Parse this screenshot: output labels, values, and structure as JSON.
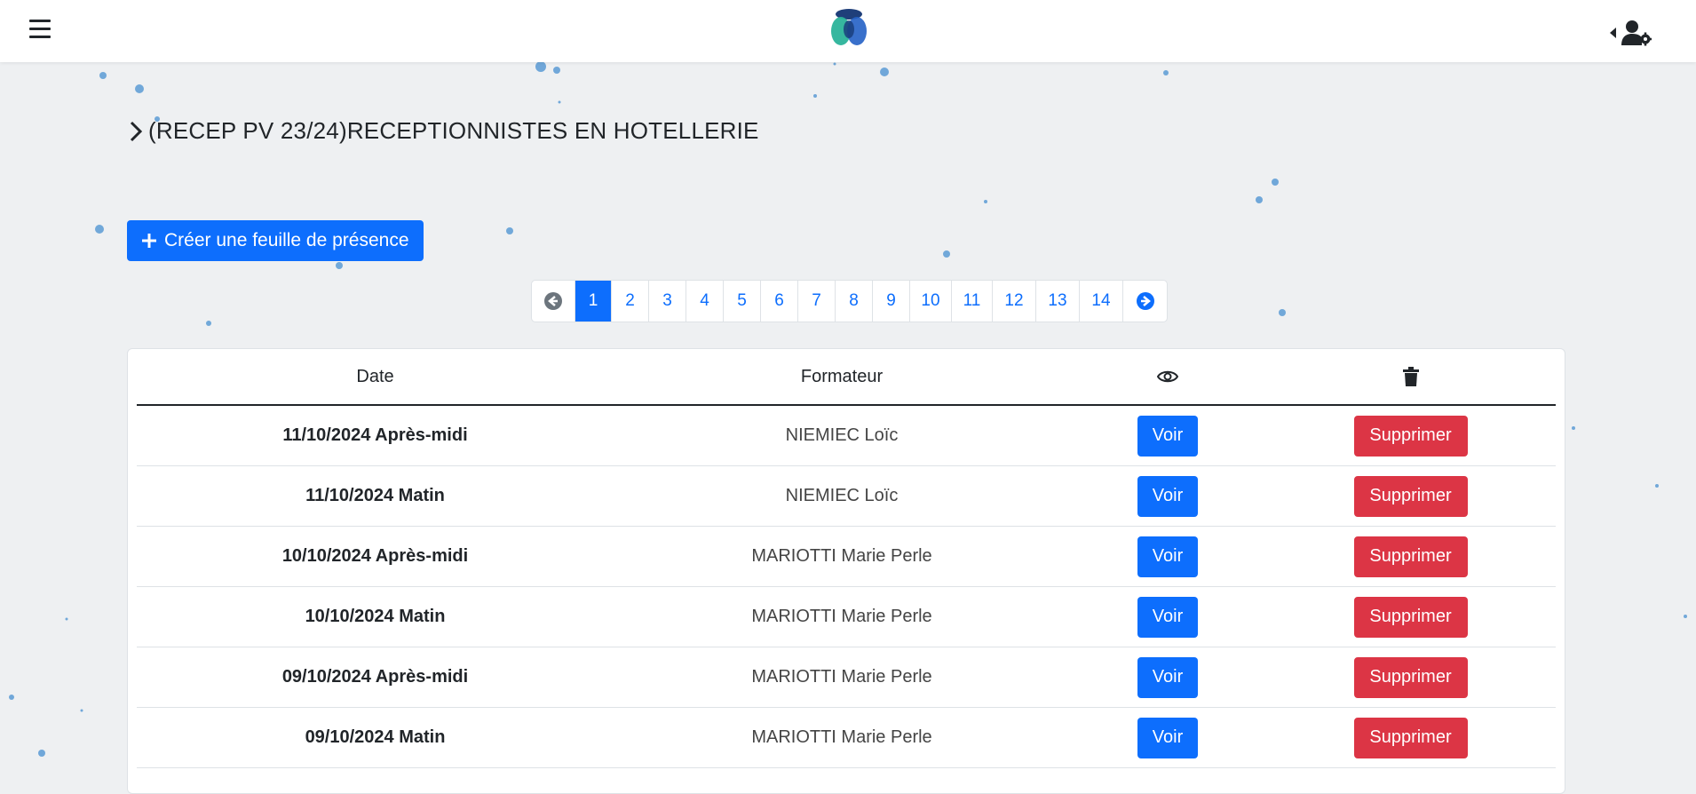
{
  "header": {
    "menu_icon": "hamburger-menu-icon",
    "logo_icon": "app-logo",
    "user_icon": "user-settings-icon"
  },
  "breadcrumb": {
    "icon": "chevron-right-icon",
    "title": "(RECEP PV 23/24)RECEPTIONNISTES EN HOTELLERIE"
  },
  "actions": {
    "create_label": "Créer une feuille de présence",
    "create_icon": "plus-icon"
  },
  "pagination": {
    "prev_icon": "arrow-circle-left-icon",
    "next_icon": "arrow-circle-right-icon",
    "active_page": "1",
    "pages": [
      "1",
      "2",
      "3",
      "4",
      "5",
      "6",
      "7",
      "8",
      "9",
      "10",
      "11",
      "12",
      "13",
      "14"
    ]
  },
  "table": {
    "headers": {
      "date": "Date",
      "trainer": "Formateur",
      "view_icon": "eye-icon",
      "delete_icon": "trash-icon"
    },
    "rows": [
      {
        "date": "11/10/2024 Après-midi",
        "trainer": "NIEMIEC Loïc",
        "view": "Voir",
        "delete": "Supprimer"
      },
      {
        "date": "11/10/2024 Matin",
        "trainer": "NIEMIEC Loïc",
        "view": "Voir",
        "delete": "Supprimer"
      },
      {
        "date": "10/10/2024 Après-midi",
        "trainer": "MARIOTTI Marie Perle",
        "view": "Voir",
        "delete": "Supprimer"
      },
      {
        "date": "10/10/2024 Matin",
        "trainer": "MARIOTTI Marie Perle",
        "view": "Voir",
        "delete": "Supprimer"
      },
      {
        "date": "09/10/2024 Après-midi",
        "trainer": "MARIOTTI Marie Perle",
        "view": "Voir",
        "delete": "Supprimer"
      },
      {
        "date": "09/10/2024 Matin",
        "trainer": "MARIOTTI Marie Perle",
        "view": "Voir",
        "delete": "Supprimer"
      }
    ]
  },
  "colors": {
    "primary": "#0d6efd",
    "danger": "#dc3545",
    "background": "#eef0f2",
    "dots": "#5b9bd5"
  }
}
